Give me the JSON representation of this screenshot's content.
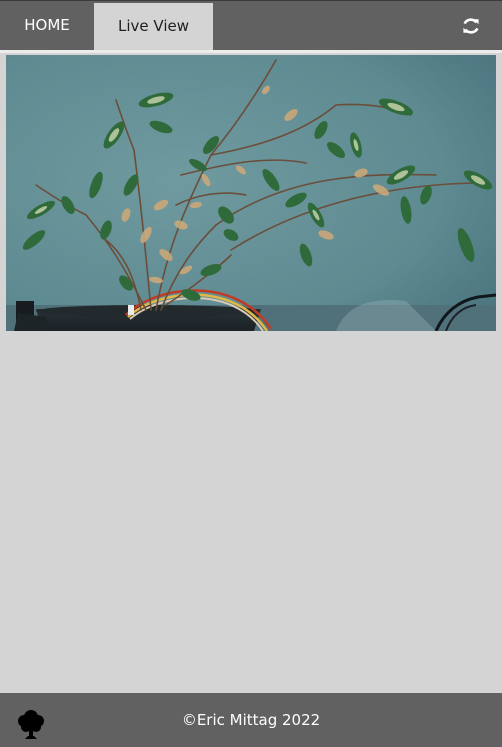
{
  "nav": {
    "home_label": "HOME",
    "live_view_label": "Live View",
    "refresh_icon": "refresh-icon"
  },
  "camera": {
    "icon": "plant-camera-feed"
  },
  "footer": {
    "copyright": "©Eric Mittag 2022",
    "logo_icon": "tree-icon"
  },
  "colors": {
    "nav_bg": "#616161",
    "page_bg": "#d4d4d4",
    "active_tab_bg": "#d4d4d4",
    "footer_bg": "#616161"
  }
}
